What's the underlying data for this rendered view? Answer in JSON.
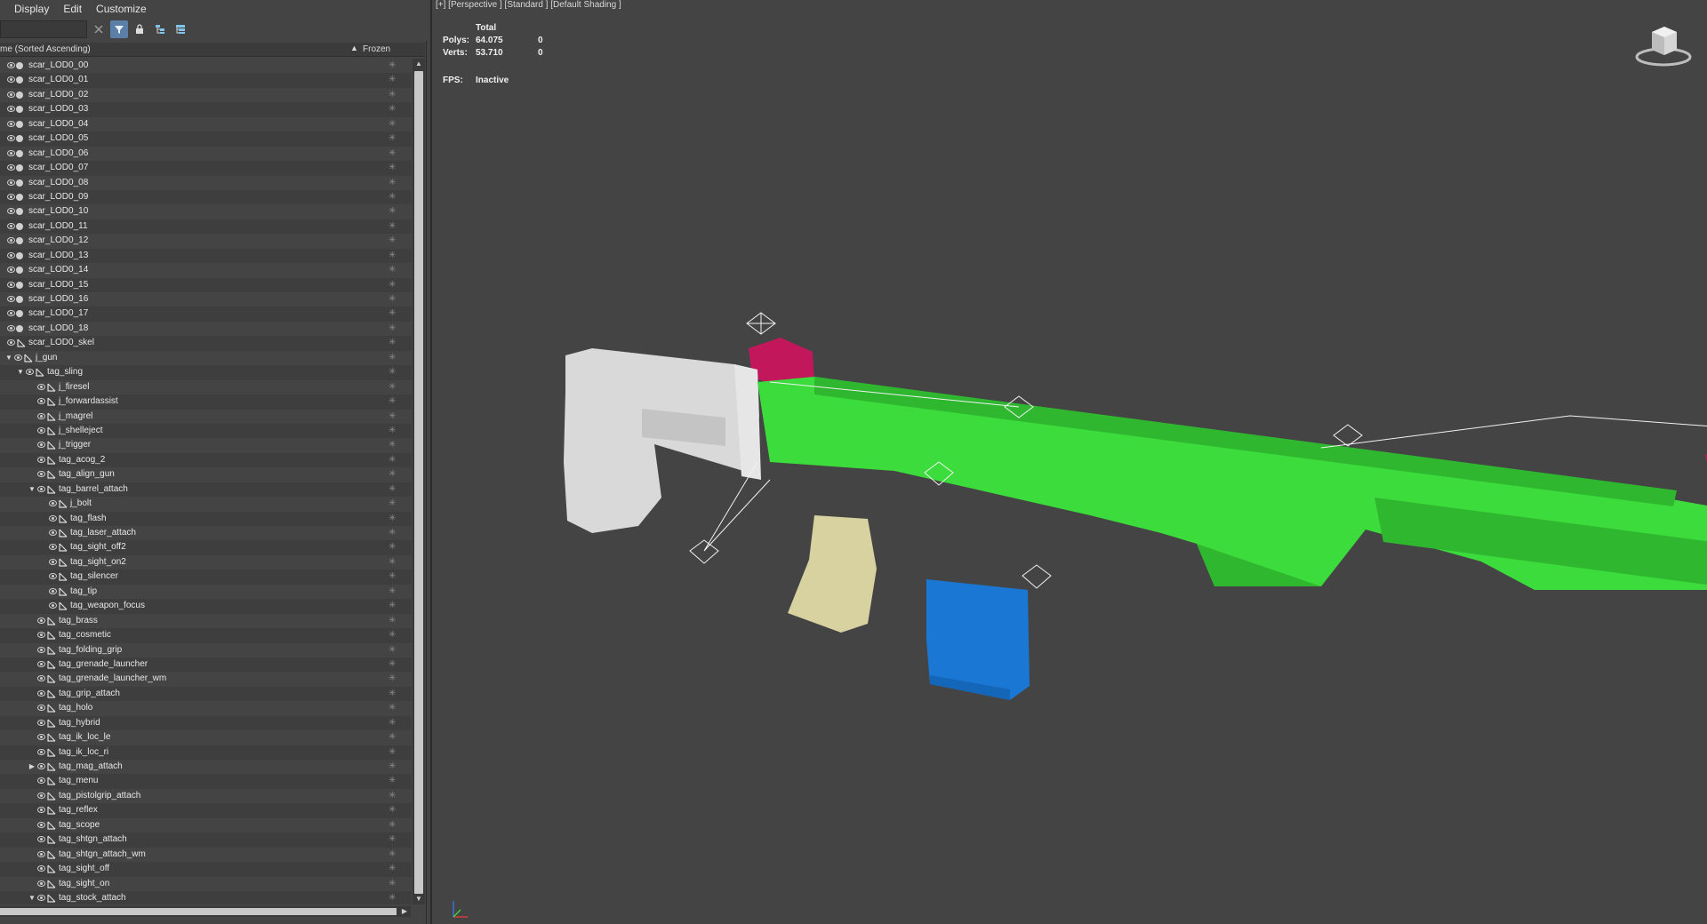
{
  "menu": [
    "Display",
    "Edit",
    "Customize"
  ],
  "search": {
    "placeholder": ""
  },
  "toolbar_icons": [
    "close-icon",
    "filter-icon",
    "lock-icon",
    "hierarchy-icon",
    "hierarchy-expand-icon"
  ],
  "columns": {
    "name": "me (Sorted Ascending)",
    "sort_indicator": "▲",
    "frozen": "Frozen"
  },
  "tree": [
    {
      "label": "scar_LOD0_00",
      "level": 0,
      "kind": "mesh"
    },
    {
      "label": "scar_LOD0_01",
      "level": 0,
      "kind": "mesh"
    },
    {
      "label": "scar_LOD0_02",
      "level": 0,
      "kind": "mesh"
    },
    {
      "label": "scar_LOD0_03",
      "level": 0,
      "kind": "mesh"
    },
    {
      "label": "scar_LOD0_04",
      "level": 0,
      "kind": "mesh"
    },
    {
      "label": "scar_LOD0_05",
      "level": 0,
      "kind": "mesh"
    },
    {
      "label": "scar_LOD0_06",
      "level": 0,
      "kind": "mesh"
    },
    {
      "label": "scar_LOD0_07",
      "level": 0,
      "kind": "mesh"
    },
    {
      "label": "scar_LOD0_08",
      "level": 0,
      "kind": "mesh"
    },
    {
      "label": "scar_LOD0_09",
      "level": 0,
      "kind": "mesh"
    },
    {
      "label": "scar_LOD0_10",
      "level": 0,
      "kind": "mesh"
    },
    {
      "label": "scar_LOD0_11",
      "level": 0,
      "kind": "mesh"
    },
    {
      "label": "scar_LOD0_12",
      "level": 0,
      "kind": "mesh"
    },
    {
      "label": "scar_LOD0_13",
      "level": 0,
      "kind": "mesh"
    },
    {
      "label": "scar_LOD0_14",
      "level": 0,
      "kind": "mesh"
    },
    {
      "label": "scar_LOD0_15",
      "level": 0,
      "kind": "mesh"
    },
    {
      "label": "scar_LOD0_16",
      "level": 0,
      "kind": "mesh"
    },
    {
      "label": "scar_LOD0_17",
      "level": 0,
      "kind": "mesh"
    },
    {
      "label": "scar_LOD0_18",
      "level": 0,
      "kind": "mesh"
    },
    {
      "label": "scar_LOD0_skel",
      "level": 0,
      "kind": "bone"
    },
    {
      "label": "j_gun",
      "level": 1,
      "kind": "bone",
      "expander": "open"
    },
    {
      "label": "tag_sling",
      "level": 2,
      "kind": "bone",
      "expander": "open"
    },
    {
      "label": "j_firesel",
      "level": 3,
      "kind": "bone"
    },
    {
      "label": "j_forwardassist",
      "level": 3,
      "kind": "bone"
    },
    {
      "label": "j_magrel",
      "level": 3,
      "kind": "bone"
    },
    {
      "label": "j_shelleject",
      "level": 3,
      "kind": "bone"
    },
    {
      "label": "j_trigger",
      "level": 3,
      "kind": "bone"
    },
    {
      "label": "tag_acog_2",
      "level": 3,
      "kind": "bone"
    },
    {
      "label": "tag_align_gun",
      "level": 3,
      "kind": "bone"
    },
    {
      "label": "tag_barrel_attach",
      "level": 3,
      "kind": "bone",
      "expander": "open"
    },
    {
      "label": "j_bolt",
      "level": 4,
      "kind": "bone"
    },
    {
      "label": "tag_flash",
      "level": 4,
      "kind": "bone"
    },
    {
      "label": "tag_laser_attach",
      "level": 4,
      "kind": "bone"
    },
    {
      "label": "tag_sight_off2",
      "level": 4,
      "kind": "bone"
    },
    {
      "label": "tag_sight_on2",
      "level": 4,
      "kind": "bone"
    },
    {
      "label": "tag_silencer",
      "level": 4,
      "kind": "bone"
    },
    {
      "label": "tag_tip",
      "level": 4,
      "kind": "bone"
    },
    {
      "label": "tag_weapon_focus",
      "level": 4,
      "kind": "bone"
    },
    {
      "label": "tag_brass",
      "level": 3,
      "kind": "bone"
    },
    {
      "label": "tag_cosmetic",
      "level": 3,
      "kind": "bone"
    },
    {
      "label": "tag_folding_grip",
      "level": 3,
      "kind": "bone"
    },
    {
      "label": "tag_grenade_launcher",
      "level": 3,
      "kind": "bone"
    },
    {
      "label": "tag_grenade_launcher_wm",
      "level": 3,
      "kind": "bone"
    },
    {
      "label": "tag_grip_attach",
      "level": 3,
      "kind": "bone"
    },
    {
      "label": "tag_holo",
      "level": 3,
      "kind": "bone"
    },
    {
      "label": "tag_hybrid",
      "level": 3,
      "kind": "bone"
    },
    {
      "label": "tag_ik_loc_le",
      "level": 3,
      "kind": "bone"
    },
    {
      "label": "tag_ik_loc_ri",
      "level": 3,
      "kind": "bone"
    },
    {
      "label": "tag_mag_attach",
      "level": 3,
      "kind": "bone",
      "expander": "closed"
    },
    {
      "label": "tag_menu",
      "level": 3,
      "kind": "bone"
    },
    {
      "label": "tag_pistolgrip_attach",
      "level": 3,
      "kind": "bone"
    },
    {
      "label": "tag_reflex",
      "level": 3,
      "kind": "bone"
    },
    {
      "label": "tag_scope",
      "level": 3,
      "kind": "bone"
    },
    {
      "label": "tag_shtgn_attach",
      "level": 3,
      "kind": "bone"
    },
    {
      "label": "tag_shtgn_attach_wm",
      "level": 3,
      "kind": "bone"
    },
    {
      "label": "tag_sight_off",
      "level": 3,
      "kind": "bone"
    },
    {
      "label": "tag_sight_on",
      "level": 3,
      "kind": "bone"
    },
    {
      "label": "tag_stock_attach",
      "level": 3,
      "kind": "bone",
      "expander": "open"
    }
  ],
  "frozen_icon": "snowflake-icon",
  "viewport": {
    "label": "[+] [Perspective ] [Standard ] [Default Shading ]",
    "stats": {
      "header": "Total",
      "polys_label": "Polys:",
      "polys_total": "64.075",
      "polys_sel": "0",
      "verts_label": "Verts:",
      "verts_total": "53.710",
      "verts_sel": "0",
      "fps_label": "FPS:",
      "fps_value": "Inactive"
    }
  },
  "colors": {
    "stock": "#d9d9d9",
    "receiver": "#3cdc3c",
    "receiver_dark": "#2fb82f",
    "sight": "#c2185b",
    "barrel": "#138f80",
    "magazine": "#1a78d4",
    "grip": "#d8d2a0",
    "viewport_bg": "#444444"
  }
}
